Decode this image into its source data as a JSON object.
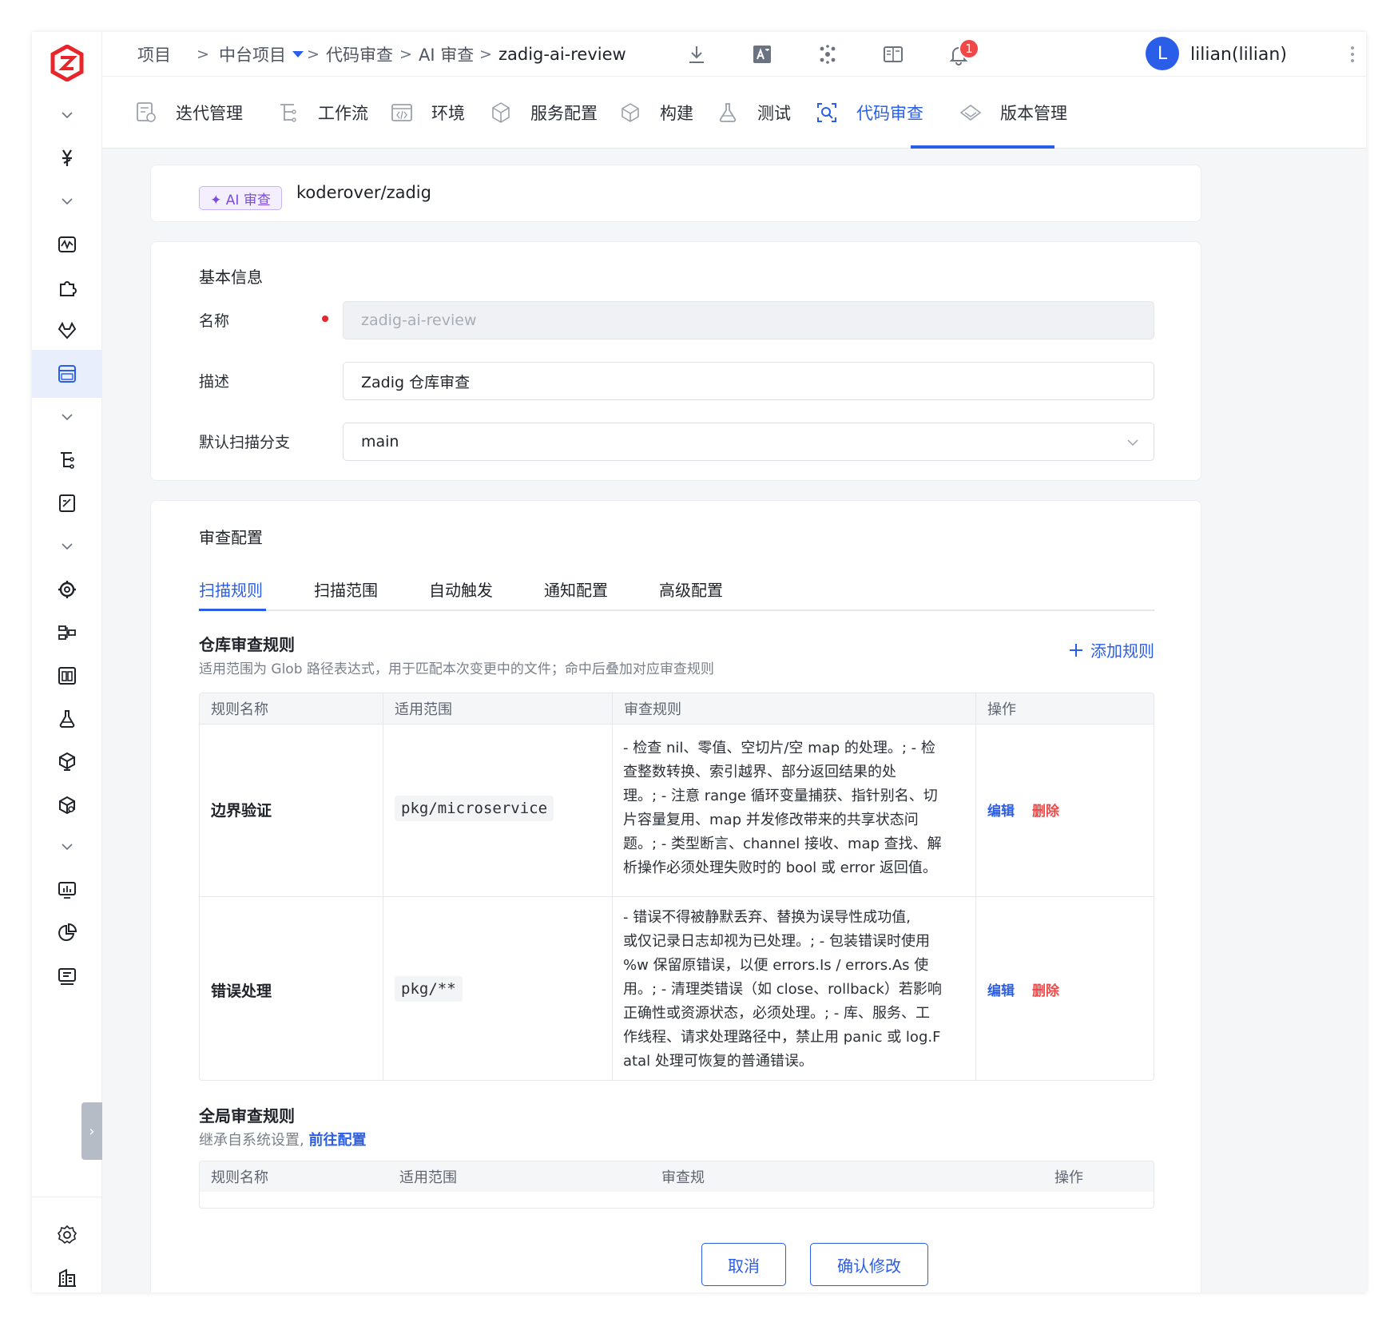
{
  "breadcrumb": {
    "items": [
      "项目",
      "中台项目",
      "代码审查",
      "AI 审查",
      "zadig-ai-review"
    ],
    "separator": ">"
  },
  "topbar": {
    "notification_count": "1",
    "avatar_letter": "L",
    "user_name": "lilian(lilian)",
    "icons": [
      "download-icon",
      "translate-icon",
      "nodes-icon",
      "book-icon",
      "bell-icon",
      "more-vertical-icon"
    ]
  },
  "nav": {
    "tabs": [
      {
        "label": "迭代管理",
        "icon": "iteration-icon"
      },
      {
        "label": "工作流",
        "icon": "workflow-icon"
      },
      {
        "label": "环境",
        "icon": "environment-icon"
      },
      {
        "label": "服务配置",
        "icon": "service-icon"
      },
      {
        "label": "构建",
        "icon": "build-icon"
      },
      {
        "label": "测试",
        "icon": "test-flask-icon"
      },
      {
        "label": "代码审查",
        "icon": "code-review-icon"
      },
      {
        "label": "版本管理",
        "icon": "version-icon"
      }
    ],
    "active_tab": "代码审查"
  },
  "header_card": {
    "tag": "✦ AI 审查",
    "repo": "koderover/zadig"
  },
  "basic_info": {
    "title": "基本信息",
    "name_label": "名称",
    "name_value": "zadig-ai-review",
    "desc_label": "描述",
    "desc_value": "Zadig 仓库审查",
    "branch_label": "默认扫描分支",
    "branch_value": "main"
  },
  "review_config": {
    "title": "审查配置",
    "tabs": [
      "扫描规则",
      "扫描范围",
      "自动触发",
      "通知配置",
      "高级配置"
    ],
    "active_tab": "扫描规则",
    "repo_rules": {
      "title": "仓库审查规则",
      "hint": "适用范围为 Glob 路径表达式，用于匹配本次变更中的文件；命中后叠加对应审查规则",
      "add_label": "添加规则",
      "columns": [
        "规则名称",
        "适用范围",
        "审查规则",
        "操作"
      ],
      "rows": [
        {
          "name": "边界验证",
          "scope": "pkg/microservice",
          "rule_lines": [
            "- 检查 nil、零值、空切片/空 map 的处理。; - 检",
            "查整数转换、索引越界、部分返回结果的处",
            "理。; - 注意 range 循环变量捕获、指针别名、切",
            "片容量复用、map 并发修改带来的共享状态问",
            "题。; - 类型断言、channel 接收、map 查找、解",
            "析操作必须处理失败时的 bool 或 error 返回值。"
          ],
          "edit": "编辑",
          "delete": "删除"
        },
        {
          "name": "错误处理",
          "scope": "pkg/**",
          "rule_lines": [
            "- 错误不得被静默丢弃、替换为误导性成功值,",
            "或仅记录日志却视为已处理。; - 包装错误时使用",
            "%w 保留原错误，以便 errors.Is / errors.As 使",
            "用。; - 清理类错误（如 close、rollback）若影响",
            "正确性或资源状态，必须处理。; - 库、服务、工",
            "作线程、请求处理路径中，禁止用 panic 或 log.F",
            "atal 处理可恢复的普通错误。"
          ],
          "edit": "编辑",
          "delete": "删除"
        }
      ]
    },
    "global_rules": {
      "title": "全局审查规则",
      "hint": "继承自系统设置,",
      "link": "前往配置",
      "columns": [
        "规则名称",
        "适用范围",
        "审查规",
        "操作"
      ]
    }
  },
  "footer": {
    "cancel": "取消",
    "confirm": "确认修改"
  },
  "colors": {
    "accent": "#2a5de8",
    "danger": "#f04848",
    "ai_tag": "#7b4ce0"
  }
}
